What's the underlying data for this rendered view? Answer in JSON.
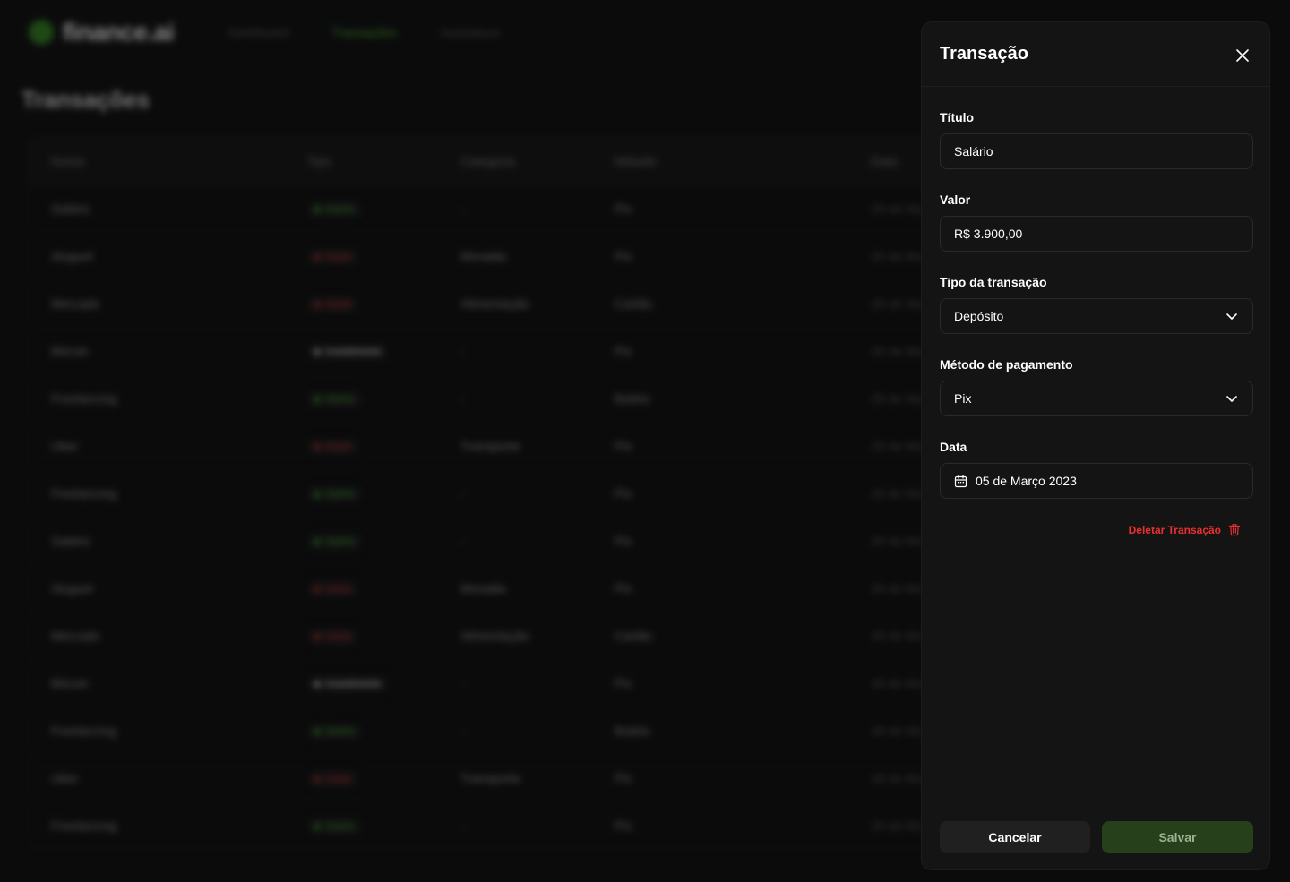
{
  "app": {
    "logo_text": "finance.ai",
    "nav": [
      {
        "label": "Dashboard"
      },
      {
        "label": "Transações"
      },
      {
        "label": "Assinatura"
      }
    ],
    "page_title": "Transações"
  },
  "table": {
    "headers": [
      "Nome",
      "Tipo",
      "Categoria",
      "Método",
      "Data"
    ],
    "rows": [
      {
        "name": "Salário",
        "type": "Ganho",
        "type_color": "#3fbf2a",
        "category": "-",
        "method": "Pix",
        "date": "28 de Ma"
      },
      {
        "name": "Aluguel",
        "type": "Gasto",
        "type_color": "#e93030",
        "category": "Moradia",
        "method": "Pix",
        "date": "28 de Ma"
      },
      {
        "name": "Mercado",
        "type": "Gasto",
        "type_color": "#e93030",
        "category": "Alimentação",
        "method": "Cartão",
        "date": "28 de Ma"
      },
      {
        "name": "Bitcoin",
        "type": "Investimento",
        "type_color": "#ffffff",
        "category": "-",
        "method": "Pix",
        "date": "28 de Ma"
      },
      {
        "name": "Freelancing",
        "type": "Ganho",
        "type_color": "#3fbf2a",
        "category": "-",
        "method": "Boleto",
        "date": "28 de Ma"
      },
      {
        "name": "Uber",
        "type": "Gasto",
        "type_color": "#e93030",
        "category": "Transporte",
        "method": "Pix",
        "date": "28 de Ma"
      },
      {
        "name": "Freelancing",
        "type": "Ganho",
        "type_color": "#3fbf2a",
        "category": "-",
        "method": "Pix",
        "date": "28 de Ma"
      },
      {
        "name": "Salário",
        "type": "Ganho",
        "type_color": "#3fbf2a",
        "category": "-",
        "method": "Pix",
        "date": "28 de Ma"
      },
      {
        "name": "Aluguel",
        "type": "Gasto",
        "type_color": "#e93030",
        "category": "Moradia",
        "method": "Pix",
        "date": "28 de Ma"
      },
      {
        "name": "Mercado",
        "type": "Gasto",
        "type_color": "#e93030",
        "category": "Alimentação",
        "method": "Cartão",
        "date": "28 de Ma"
      },
      {
        "name": "Bitcoin",
        "type": "Investimento",
        "type_color": "#ffffff",
        "category": "-",
        "method": "Pix",
        "date": "28 de Ma"
      },
      {
        "name": "Freelancing",
        "type": "Ganho",
        "type_color": "#3fbf2a",
        "category": "-",
        "method": "Boleto",
        "date": "28 de Ma"
      },
      {
        "name": "Uber",
        "type": "Gasto",
        "type_color": "#e93030",
        "category": "Transporte",
        "method": "Pix",
        "date": "28 de Ma"
      },
      {
        "name": "Freelancing",
        "type": "Ganho",
        "type_color": "#3fbf2a",
        "category": "-",
        "method": "Pix",
        "date": "28 de Ma"
      }
    ]
  },
  "sheet": {
    "title": "Transação",
    "close_icon": "close-icon",
    "fields": {
      "titulo": {
        "label": "Título",
        "value": "Salário"
      },
      "valor": {
        "label": "Valor",
        "value": "R$ 3.900,00"
      },
      "tipo": {
        "label": "Tipo da transação",
        "value": "Depósito"
      },
      "metodo": {
        "label": "Método de pagamento",
        "value": "Pix"
      },
      "data": {
        "label": "Data",
        "value": "05 de Março 2023"
      }
    },
    "delete_label": "Deletar Transação",
    "cancel_label": "Cancelar",
    "save_label": "Salvar",
    "colors": {
      "danger": "#e93030",
      "save_bg": "#26401c"
    }
  }
}
